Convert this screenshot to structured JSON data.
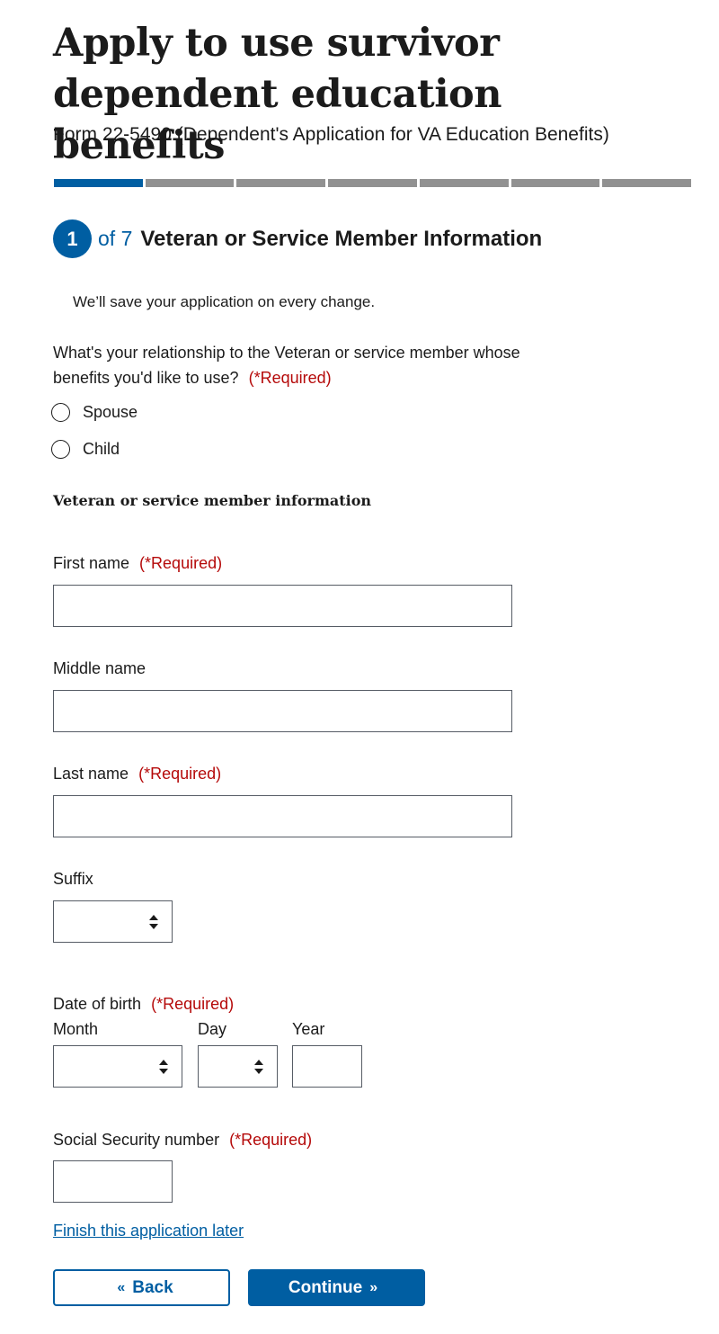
{
  "header": {
    "title": "Apply to use survivor dependent education benefits",
    "subtitle": "Form 22-5490 (Dependent's Application for VA Education Benefits)"
  },
  "progress": {
    "current_step": 1,
    "total_steps": 7
  },
  "step": {
    "number": "1",
    "of_text": "of 7",
    "title": "Veteran or Service Member Information"
  },
  "save_note": "We’ll save your application on every change.",
  "relationship": {
    "question": "What's your relationship to the Veteran or service member whose benefits you'd like to use?",
    "required": "(*Required)",
    "options": [
      "Spouse",
      "Child"
    ]
  },
  "section_heading": "Veteran or service member information",
  "fields": {
    "first_name": {
      "label": "First name",
      "required": "(*Required)",
      "value": ""
    },
    "middle_name": {
      "label": "Middle name",
      "value": ""
    },
    "last_name": {
      "label": "Last name",
      "required": "(*Required)",
      "value": ""
    },
    "suffix": {
      "label": "Suffix",
      "value": ""
    },
    "dob": {
      "label": "Date of birth",
      "required": "(*Required)",
      "month_label": "Month",
      "day_label": "Day",
      "year_label": "Year",
      "month_value": "",
      "day_value": "",
      "year_value": ""
    },
    "ssn": {
      "label": "Social Security number",
      "required": "(*Required)",
      "value": ""
    }
  },
  "links": {
    "finish_later": "Finish this application later"
  },
  "buttons": {
    "back": "Back",
    "continue": "Continue"
  },
  "icons": {
    "back_chevron": "double-chevron-left-icon",
    "continue_chevron": "double-chevron-right-icon",
    "select_arrows": "select-arrows-icon"
  },
  "colors": {
    "primary": "#005ea2",
    "required": "#b50909",
    "progress_inactive": "#919191"
  }
}
